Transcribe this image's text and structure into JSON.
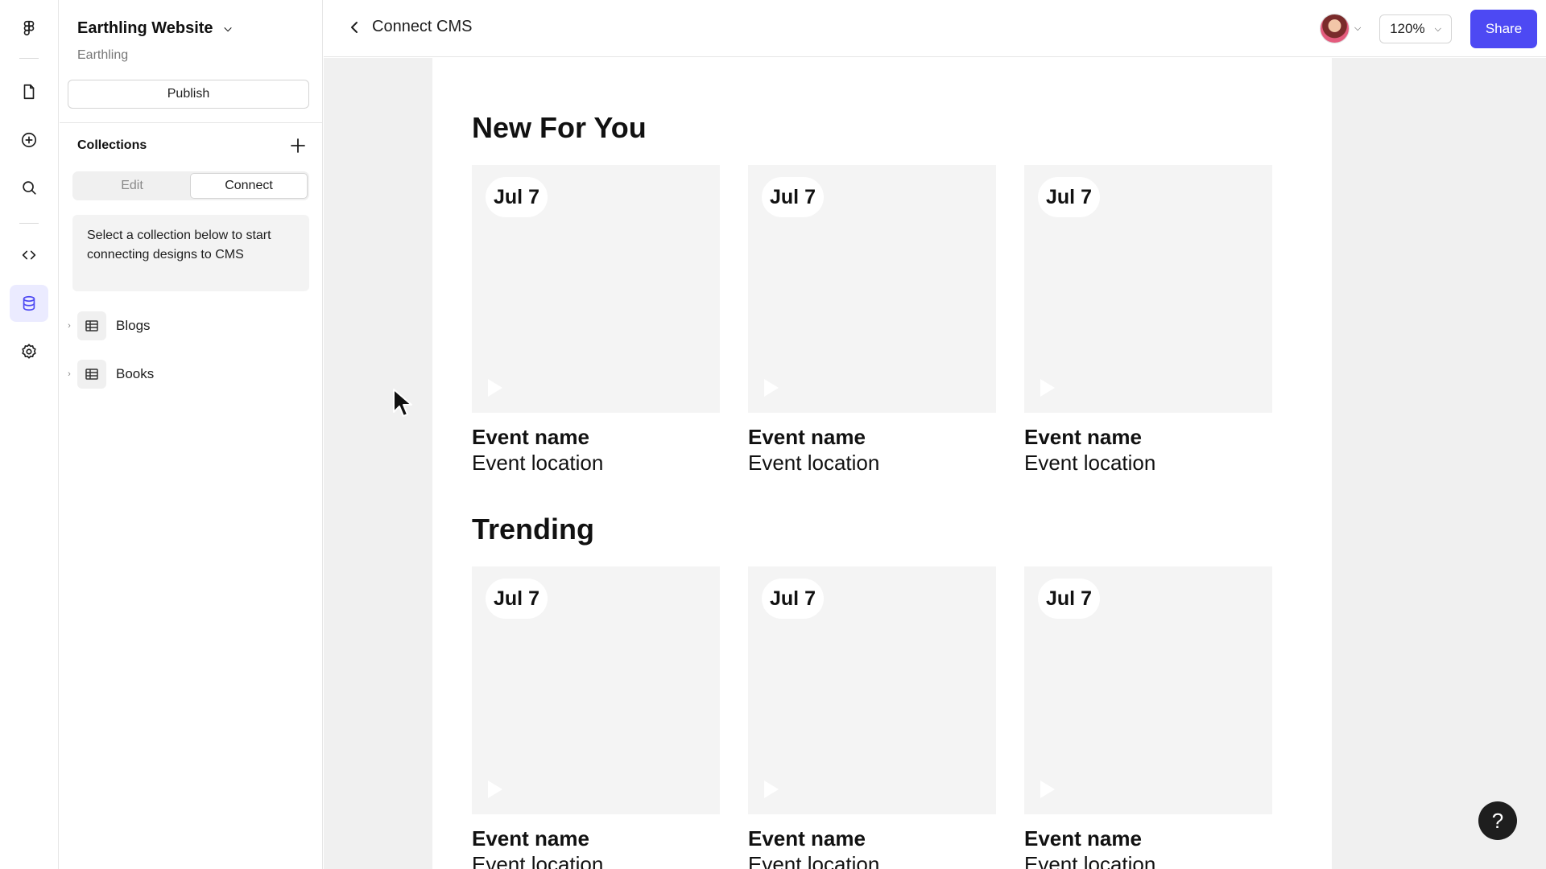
{
  "project": {
    "title": "Earthling Website",
    "subtitle": "Earthling"
  },
  "panel": {
    "publish_label": "Publish",
    "collections_label": "Collections",
    "tabs": [
      {
        "label": "Edit"
      },
      {
        "label": "Connect"
      }
    ],
    "info_text": "Select a collection below to start connecting designs to CMS",
    "collections": [
      {
        "label": "Blogs"
      },
      {
        "label": "Books"
      }
    ]
  },
  "topbar": {
    "back_label": "Connect CMS",
    "zoom": "120%",
    "share_label": "Share"
  },
  "canvas": {
    "sections": [
      {
        "title": "New For You",
        "cards": [
          {
            "date": "Jul 7",
            "name": "Event name",
            "location": "Event location"
          },
          {
            "date": "Jul 7",
            "name": "Event name",
            "location": "Event location"
          },
          {
            "date": "Jul 7",
            "name": "Event name",
            "location": "Event location"
          }
        ]
      },
      {
        "title": "Trending",
        "cards": [
          {
            "date": "Jul 7",
            "name": "Event name",
            "location": "Event location"
          },
          {
            "date": "Jul 7",
            "name": "Event name",
            "location": "Event location"
          },
          {
            "date": "Jul 7",
            "name": "Event name",
            "location": "Event location"
          }
        ]
      }
    ]
  },
  "help_label": "?",
  "colors": {
    "accent": "#4d49f3",
    "active_bg": "#ebebff",
    "canvas_bg": "#f0f0f0"
  }
}
